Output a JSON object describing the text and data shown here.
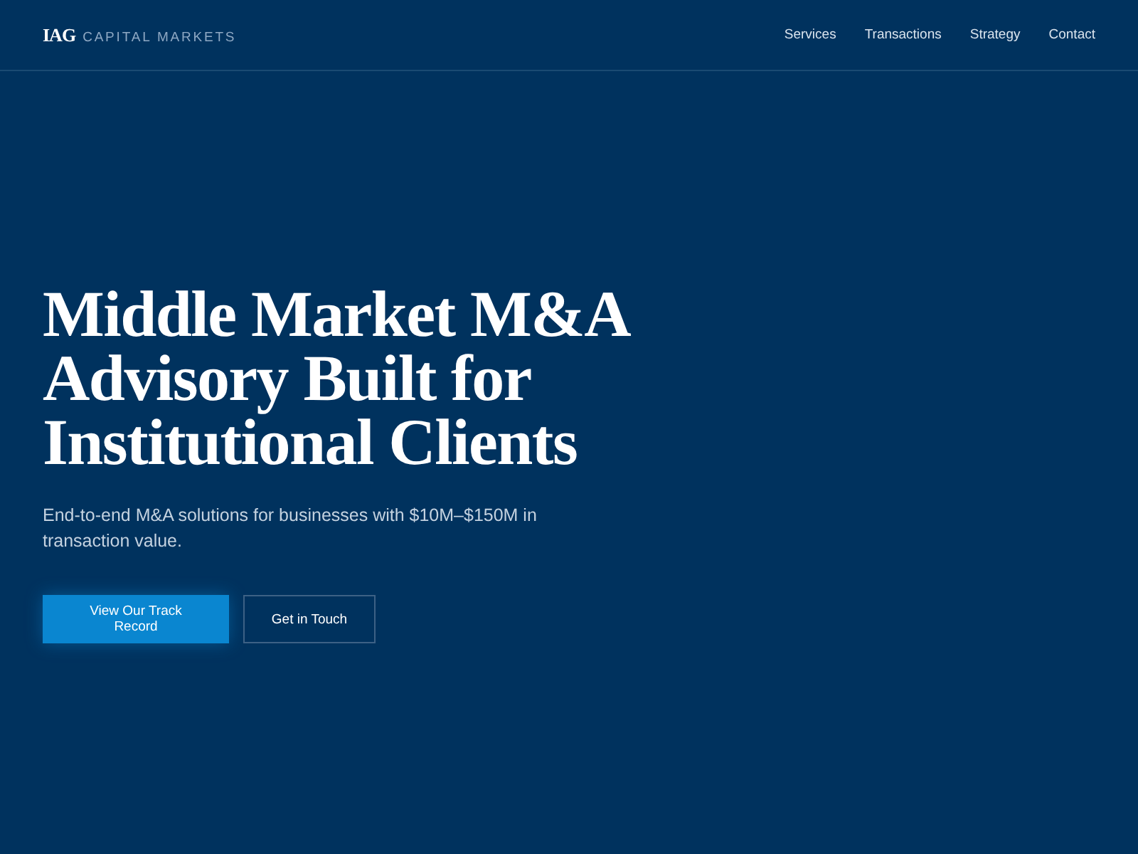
{
  "brand": {
    "mark": "IAG",
    "name": "CAPITAL MARKETS"
  },
  "nav": [
    {
      "label": "Services"
    },
    {
      "label": "Transactions"
    },
    {
      "label": "Strategy"
    },
    {
      "label": "Contact"
    }
  ],
  "hero": {
    "title": "Middle Market M&A Advisory Built for Institutional Clients",
    "subtitle": "End-to-end M&A solutions for businesses with $10M–$150M in transaction value.",
    "buttons": [
      {
        "label": "View Our Track Record",
        "kind": "primary"
      },
      {
        "label": "Get in Touch",
        "kind": "outline"
      }
    ]
  }
}
